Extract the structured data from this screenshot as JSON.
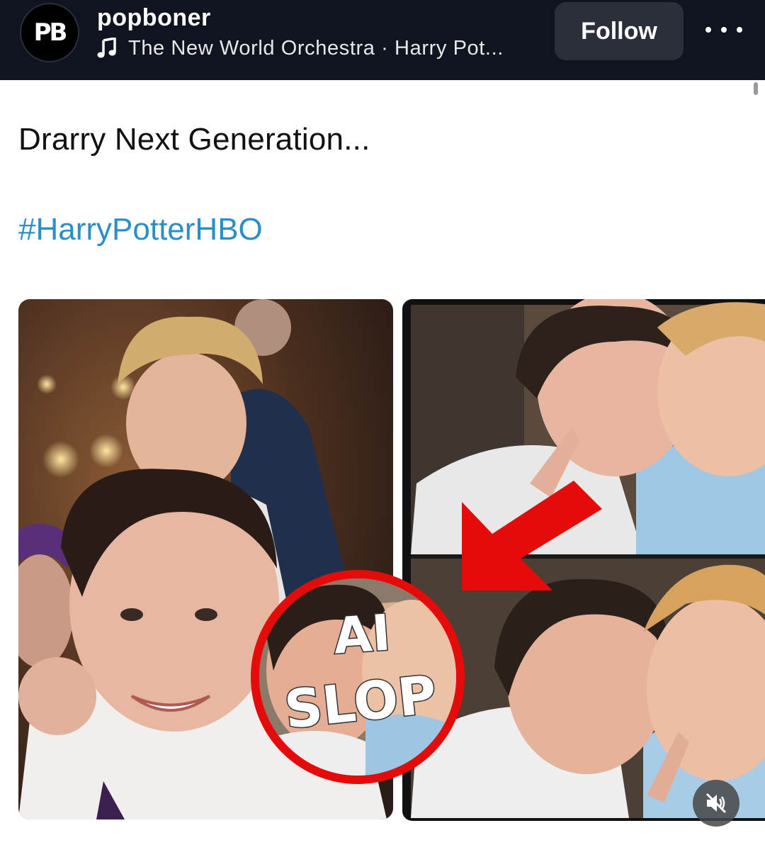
{
  "header": {
    "avatar_text": "PB",
    "username": "popboner",
    "music_text": "The New World Orchestra · Harry Pot...",
    "follow_label": "Follow"
  },
  "post": {
    "caption": "Drarry Next Generation...",
    "hashtag": "#HarryPotterHBO"
  },
  "overlay": {
    "badge_line1": "AI",
    "badge_line2": "SLOP"
  },
  "icons": {
    "music": "music-note-icon",
    "more": "more-options-icon",
    "mute": "mute-icon",
    "arrow": "red-arrow-icon"
  },
  "colors": {
    "header_bg": "#0f1420",
    "follow_bg": "#2a2f39",
    "hashtag": "#2a8fc9",
    "badge_ring": "#e60b0b",
    "arrow": "#e60b0b"
  }
}
